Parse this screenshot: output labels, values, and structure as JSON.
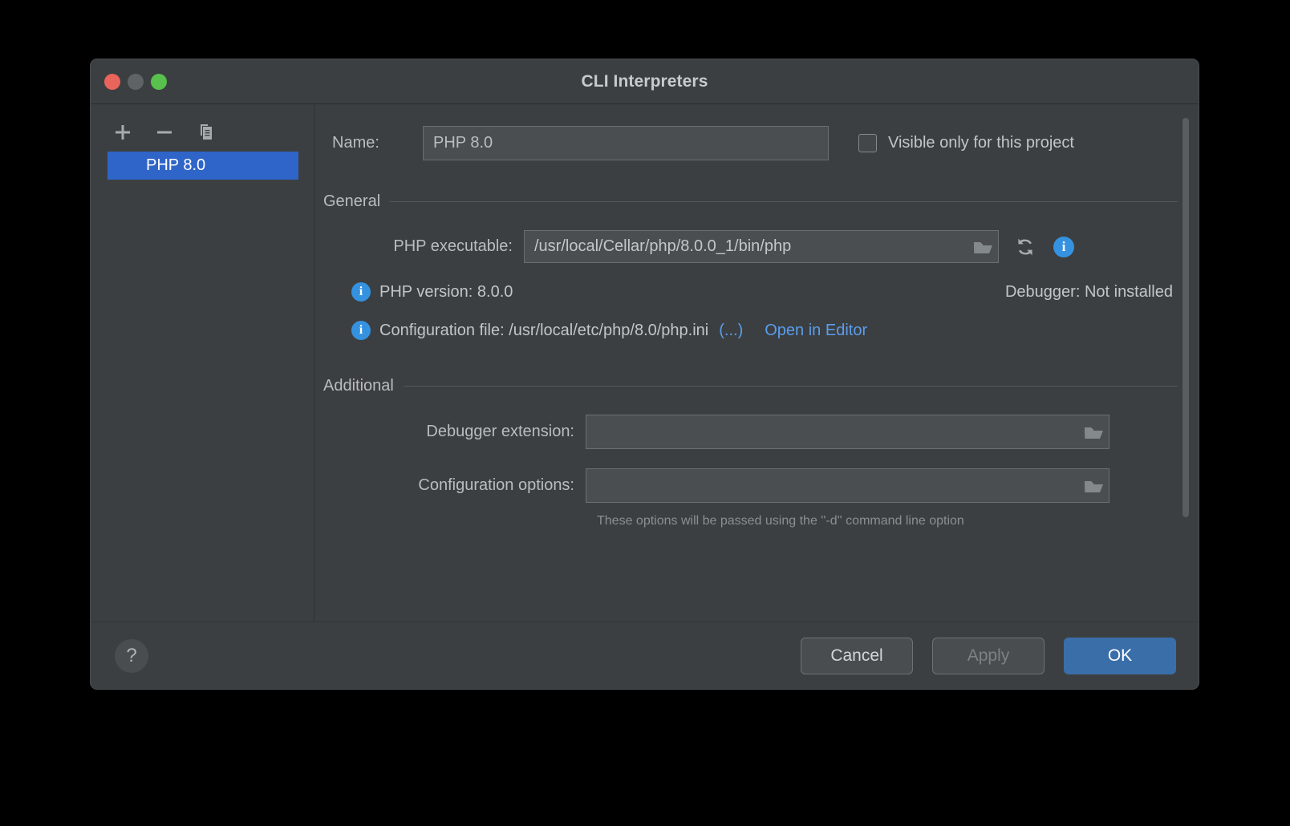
{
  "window": {
    "title": "CLI Interpreters",
    "traffic_lights": [
      "close-button",
      "minimize-button",
      "zoom-button"
    ]
  },
  "sidebar": {
    "toolbar": {
      "add_label": "+",
      "remove_label": "−",
      "copy_label": "copy"
    },
    "items": [
      {
        "label": "PHP 8.0",
        "selected": true
      }
    ]
  },
  "form": {
    "name_label": "Name:",
    "name_value": "PHP 8.0",
    "name_placeholder": "",
    "visible_only_label": "Visible only for this project",
    "visible_only_checked": false
  },
  "general": {
    "section_title": "General",
    "php_executable_label": "PHP executable:",
    "php_executable_value": "/usr/local/Cellar/php/8.0.0_1/bin/php",
    "php_executable_placeholder": "",
    "php_version_text": "PHP version: 8.0.0",
    "debugger_status": "Debugger: Not installed",
    "config_file_text": "Configuration file: /usr/local/etc/php/8.0/php.ini",
    "config_more_link": "(...)",
    "open_in_editor_link": "Open in Editor"
  },
  "additional": {
    "section_title": "Additional",
    "debugger_extension_label": "Debugger extension:",
    "debugger_extension_value": "",
    "debugger_extension_placeholder": "",
    "configuration_options_label": "Configuration options:",
    "configuration_options_value": "",
    "configuration_options_placeholder": "",
    "hint": "These options will be passed using the ''-d'' command line option"
  },
  "footer": {
    "help_label": "?",
    "cancel_label": "Cancel",
    "apply_label": "Apply",
    "apply_enabled": false,
    "ok_label": "OK"
  },
  "colors": {
    "window_bg": "#3c3f41",
    "selection_blue": "#2f65c9",
    "primary_button": "#3a6ea8",
    "link_blue": "#5a9ded",
    "info_blue": "#3592e0",
    "close_red": "#e9645a",
    "minimize_gray": "#5f6365",
    "zoom_green": "#58c04d"
  }
}
